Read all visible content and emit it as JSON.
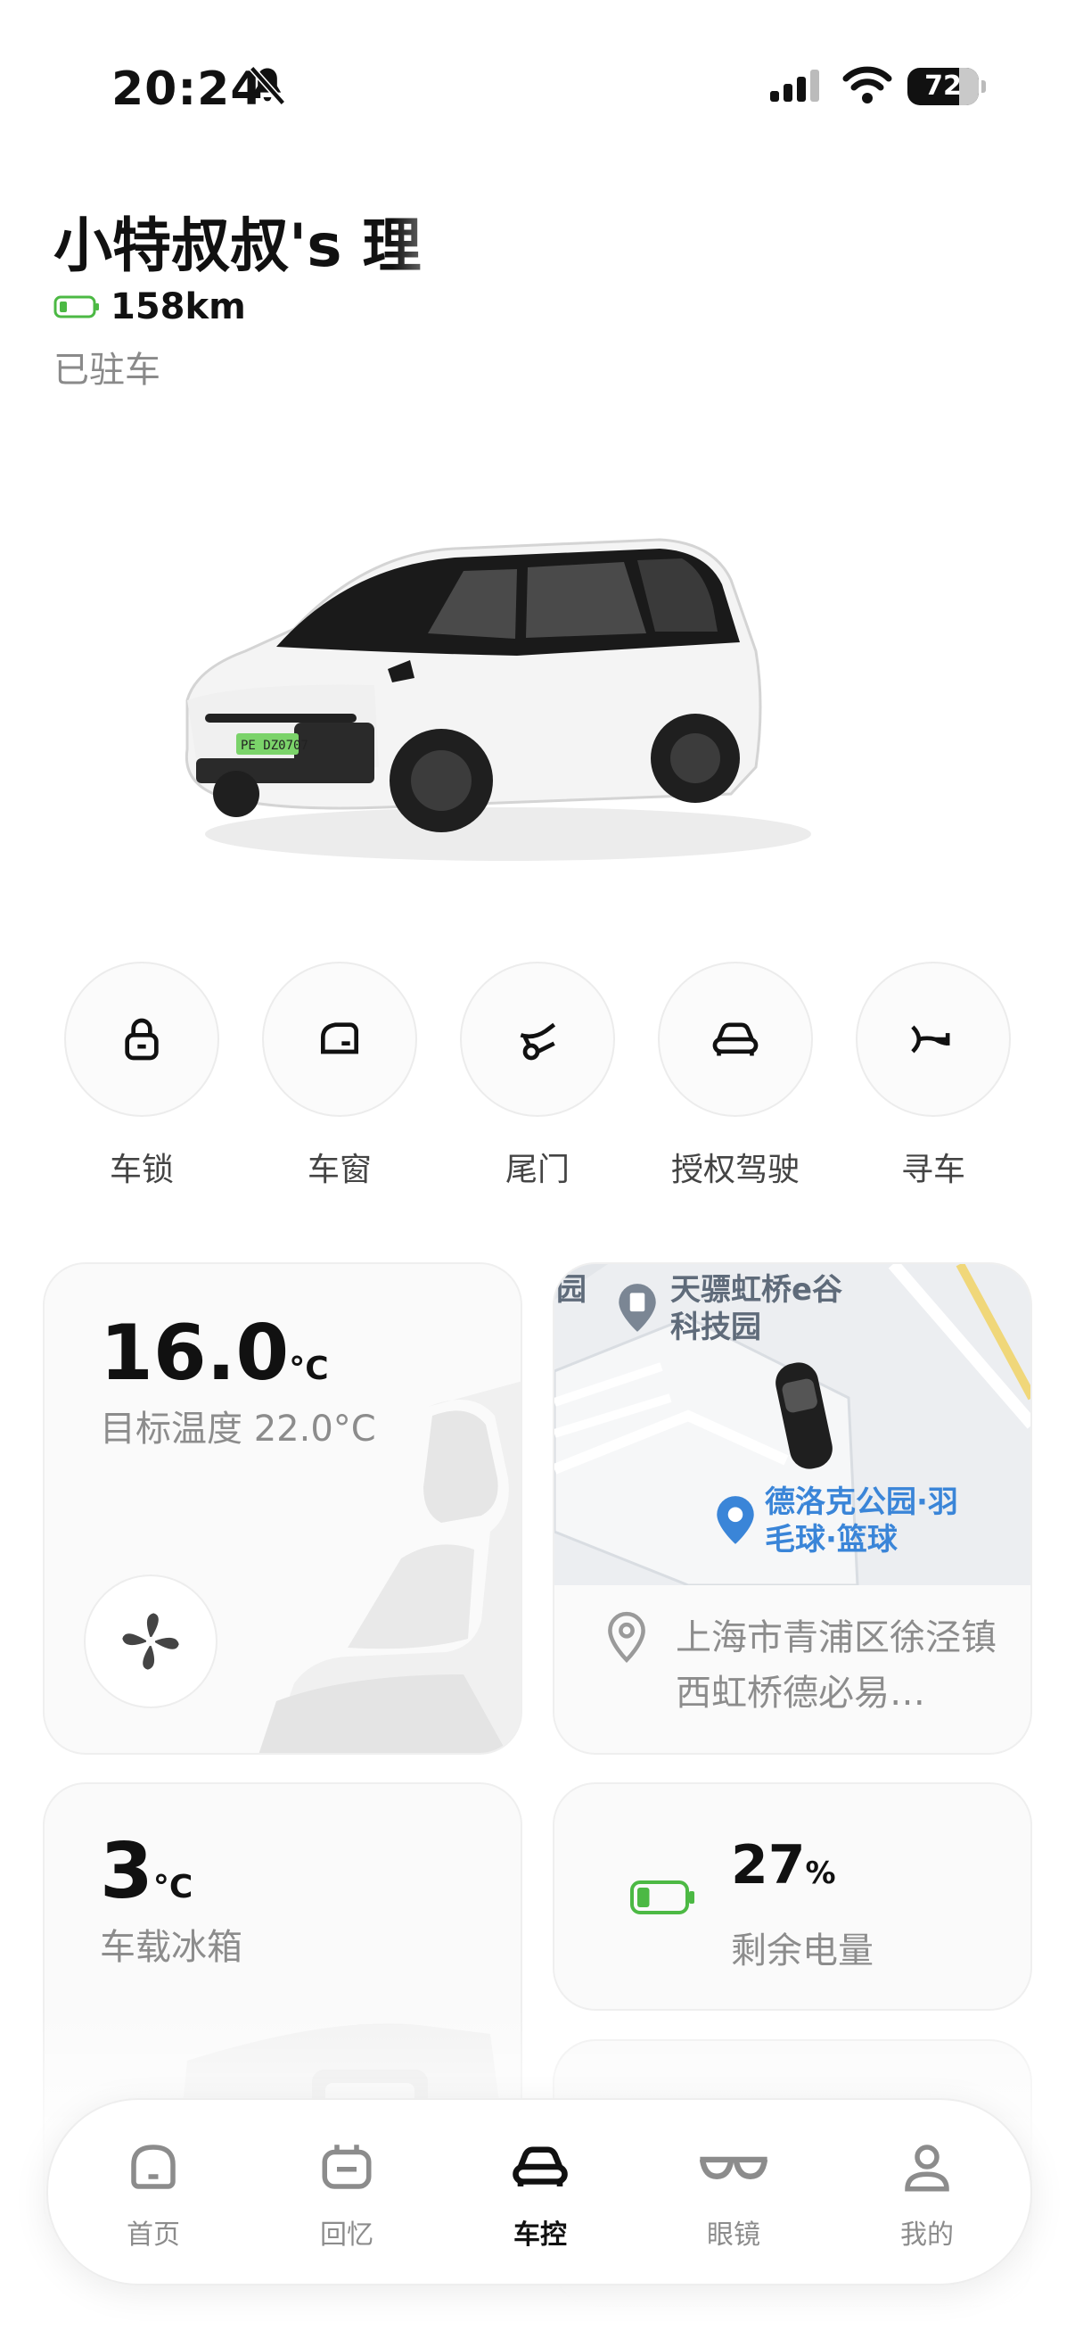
{
  "status_bar": {
    "time": "20:24",
    "battery_level": "72",
    "mute_icon": "bell-slash-icon",
    "signal_icon": "cellular-signal-icon",
    "wifi_icon": "wifi-icon"
  },
  "vehicle": {
    "name": "小特叔叔's 理",
    "range": "158km",
    "status": "已驻车",
    "plate": "PE DZ0707",
    "battery_color": "#4cb944"
  },
  "controls": [
    {
      "label": "车锁",
      "icon": "lock-icon"
    },
    {
      "label": "车窗",
      "icon": "car-window-icon"
    },
    {
      "label": "尾门",
      "icon": "tailgate-icon"
    },
    {
      "label": "授权驾驶",
      "icon": "car-front-icon"
    },
    {
      "label": "寻车",
      "icon": "horn-icon"
    }
  ],
  "climate": {
    "current_temp": "16.0",
    "unit": "°C",
    "target": "目标温度 22.0°C",
    "fan_icon": "fan-icon"
  },
  "location": {
    "poi_1": [
      "天骠虹桥e谷",
      "科技园"
    ],
    "poi_2": [
      "德洛克公园·羽",
      "毛球·篮球"
    ],
    "map_fragment": "园",
    "address": "上海市青浦区徐泾镇西虹桥德必易…"
  },
  "fridge": {
    "temp": "3",
    "unit": "°C",
    "label": "车载冰箱"
  },
  "battery": {
    "percent": "27",
    "unit": "%",
    "label": "剩余电量",
    "level_fraction": 0.27
  },
  "nav": [
    {
      "label": "首页",
      "icon": "home-icon",
      "active": false
    },
    {
      "label": "回忆",
      "icon": "memories-icon",
      "active": false
    },
    {
      "label": "车控",
      "icon": "car-control-icon",
      "active": true
    },
    {
      "label": "眼镜",
      "icon": "glasses-icon",
      "active": false
    },
    {
      "label": "我的",
      "icon": "profile-icon",
      "active": false
    }
  ],
  "colors": {
    "accent_green": "#4cb944",
    "map_blue": "#3a85d8",
    "road_yellow": "#f0d77a"
  }
}
